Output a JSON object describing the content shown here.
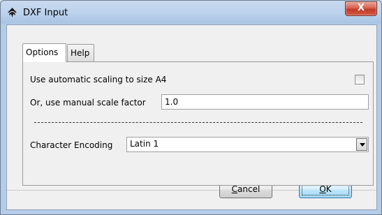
{
  "window": {
    "title": "DXF Input",
    "close_label": "X",
    "icon": "inkscape-icon"
  },
  "tabs": [
    {
      "label": "Options",
      "active": true
    },
    {
      "label": "Help",
      "active": false
    }
  ],
  "options": {
    "auto_scaling_label": "Use automatic scaling to size A4",
    "auto_scaling_checked": false,
    "manual_scale_label": "Or, use manual scale factor",
    "manual_scale_value": "1.0",
    "separator_text": "------------------------------------------------------------------------------------",
    "encoding_label": "Character Encoding",
    "encoding_value": "Latin 1"
  },
  "buttons": {
    "cancel_rest": "ancel",
    "cancel_mnemonic": "C",
    "ok_mnemonic": "O",
    "ok_rest": "K"
  }
}
